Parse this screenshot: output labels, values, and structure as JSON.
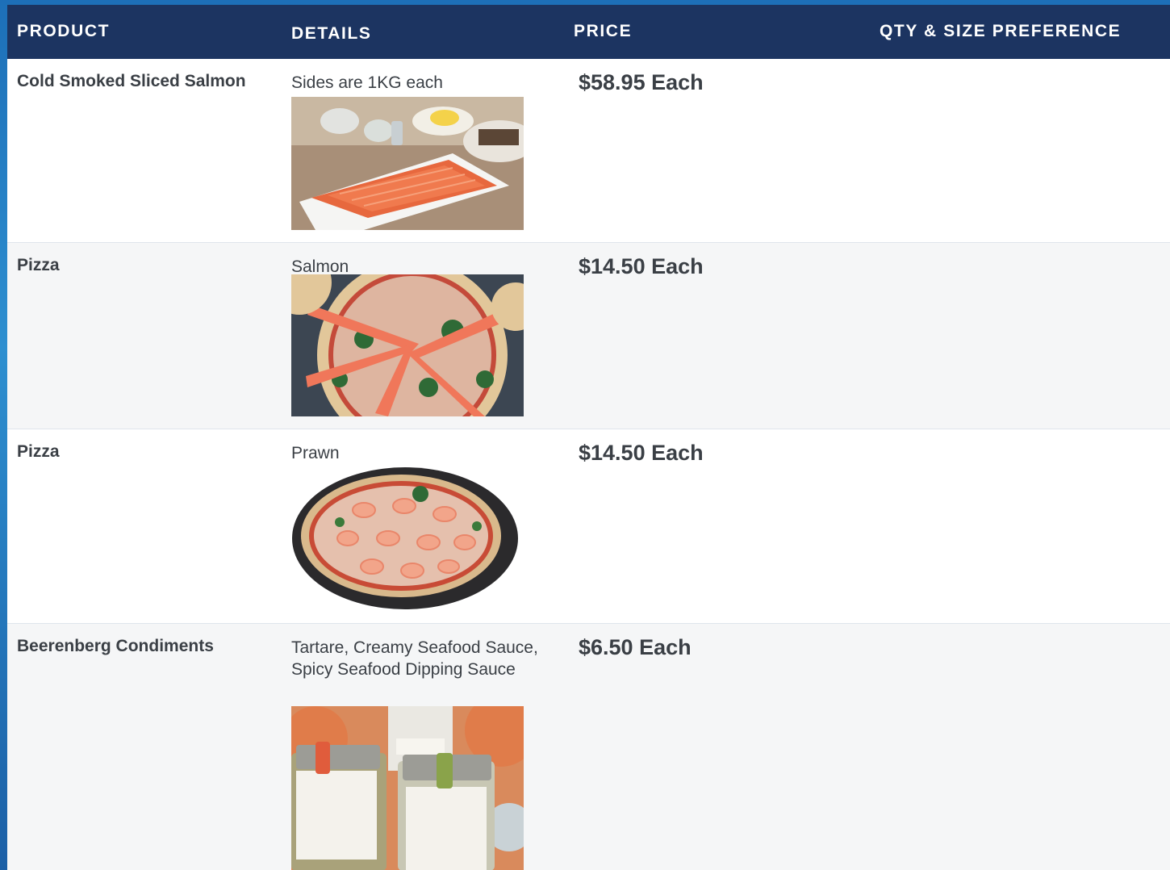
{
  "table": {
    "headers": {
      "product": "PRODUCT",
      "details": "DETAILS",
      "price": "PRICE",
      "qty": "QTY & SIZE PREFERENCE"
    },
    "rows": [
      {
        "product": "Cold Smoked Sliced Salmon",
        "details": "Sides are 1KG each",
        "price": "$58.95 Each",
        "image": "smoked-salmon-side-photo"
      },
      {
        "product": "Pizza",
        "details": "Salmon",
        "price": "$14.50 Each",
        "image": "salmon-pizza-photo"
      },
      {
        "product": "Pizza",
        "details": "Prawn",
        "price": "$14.50 Each",
        "image": "prawn-pizza-photo"
      },
      {
        "product": "Beerenberg Condiments",
        "details": "Tartare, Creamy Seafood Sauce, Spicy Seafood Dipping Sauce",
        "price": "$6.50 Each",
        "image": "beerenberg-sauces-photo"
      }
    ]
  },
  "colors": {
    "header_bg": "#1c3461",
    "header_text": "#ffffff",
    "body_text": "#3a3f45",
    "alt_row": "#f5f6f7"
  }
}
